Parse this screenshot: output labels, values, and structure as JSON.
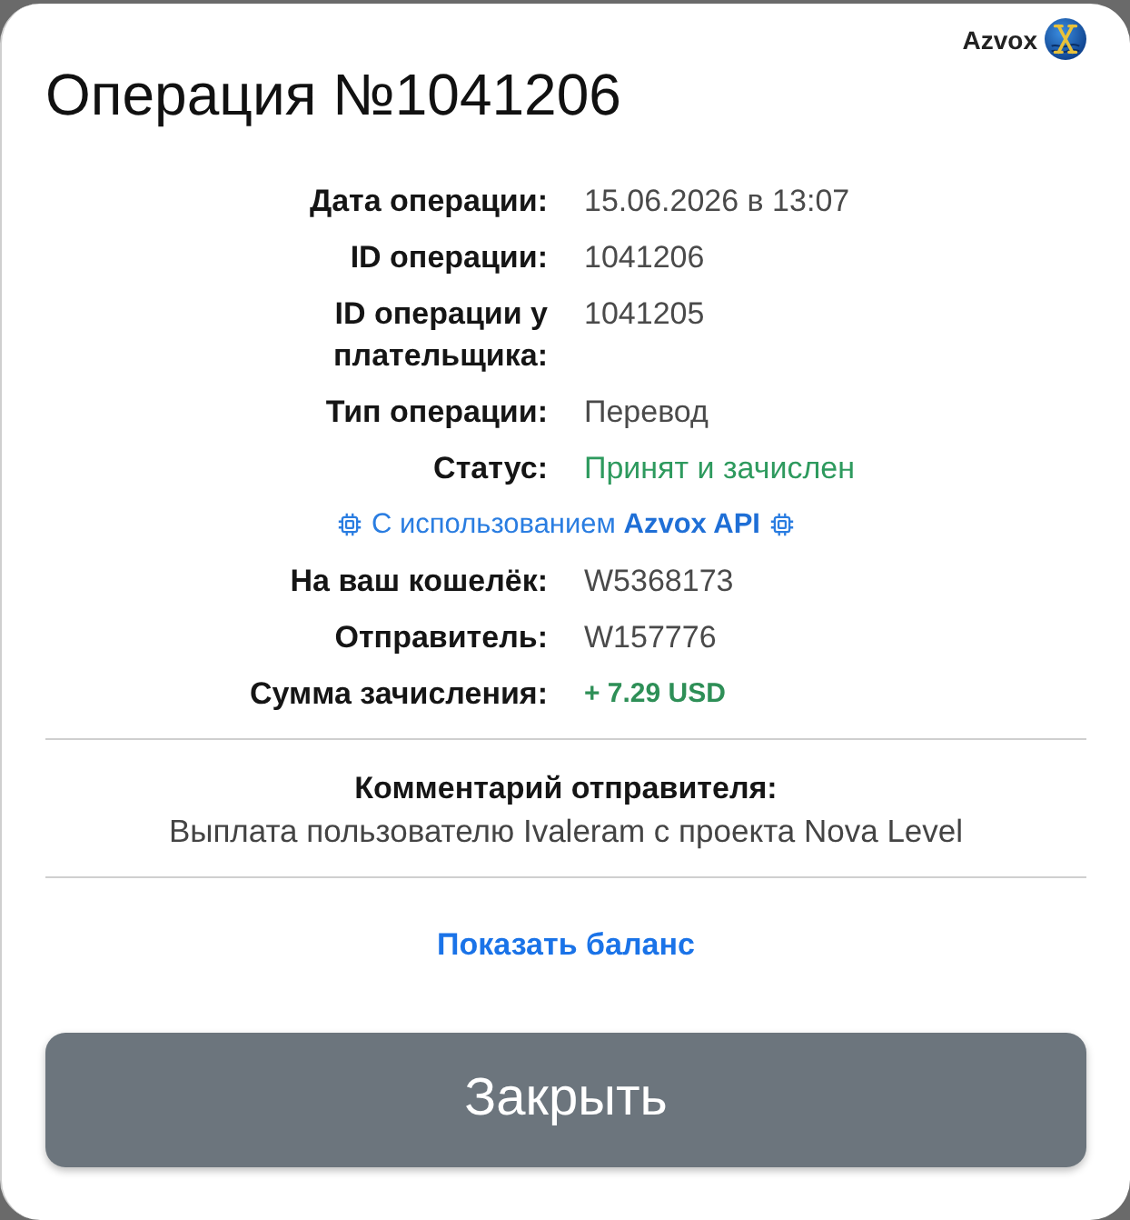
{
  "header": {
    "brand": "Azvox",
    "title": "Операция №1041206"
  },
  "details": [
    {
      "kind": "field",
      "label": "Дата операции:",
      "value": "15.06.2026 в 13:07"
    },
    {
      "kind": "field",
      "label": "ID операции:",
      "value": "1041206"
    },
    {
      "kind": "field",
      "label": "ID операции у плательщика:",
      "value": "1041205"
    },
    {
      "kind": "field",
      "label": "Тип операции:",
      "value": "Перевод"
    },
    {
      "kind": "status",
      "label": "Статус:",
      "value": "Принят и зачислен"
    },
    {
      "kind": "note",
      "text": "С использованием **Azvox API**"
    },
    {
      "kind": "field",
      "label": "На ваш кошелёк:",
      "value": "W5368173"
    },
    {
      "kind": "field",
      "label": "Отправитель:",
      "value": "W157776"
    },
    {
      "kind": "amount",
      "label": "Сумма зачисления:",
      "value": "+ 7.29 USD"
    }
  ],
  "comment": {
    "heading": "Комментарий отправителя:",
    "text": "Выплата пользователю Ivaleram с проекта Nova Level"
  },
  "balance_link": "Показать баланс",
  "close_button": "Закрыть"
}
